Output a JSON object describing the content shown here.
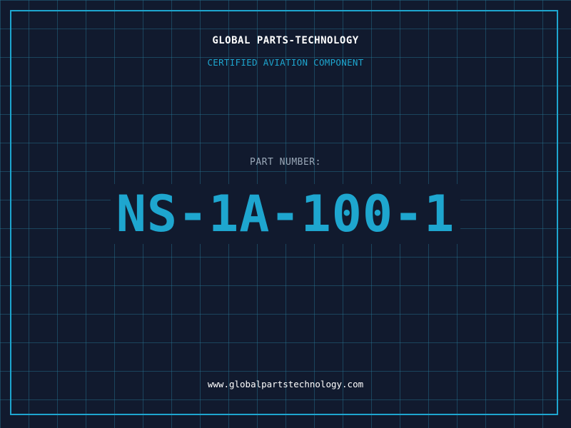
{
  "header": {
    "company": "GLOBAL PARTS-TECHNOLOGY",
    "subtitle": "CERTIFIED AVIATION COMPONENT"
  },
  "part": {
    "label": "PART NUMBER:",
    "number": "NS-1A-100-1"
  },
  "footer": {
    "website": "www.globalpartstechnology.com"
  },
  "colors": {
    "background": "#111a2e",
    "grid": "#287896",
    "accent": "#1ea6cf",
    "text": "#ffffff",
    "muted": "#9aa8b8"
  }
}
